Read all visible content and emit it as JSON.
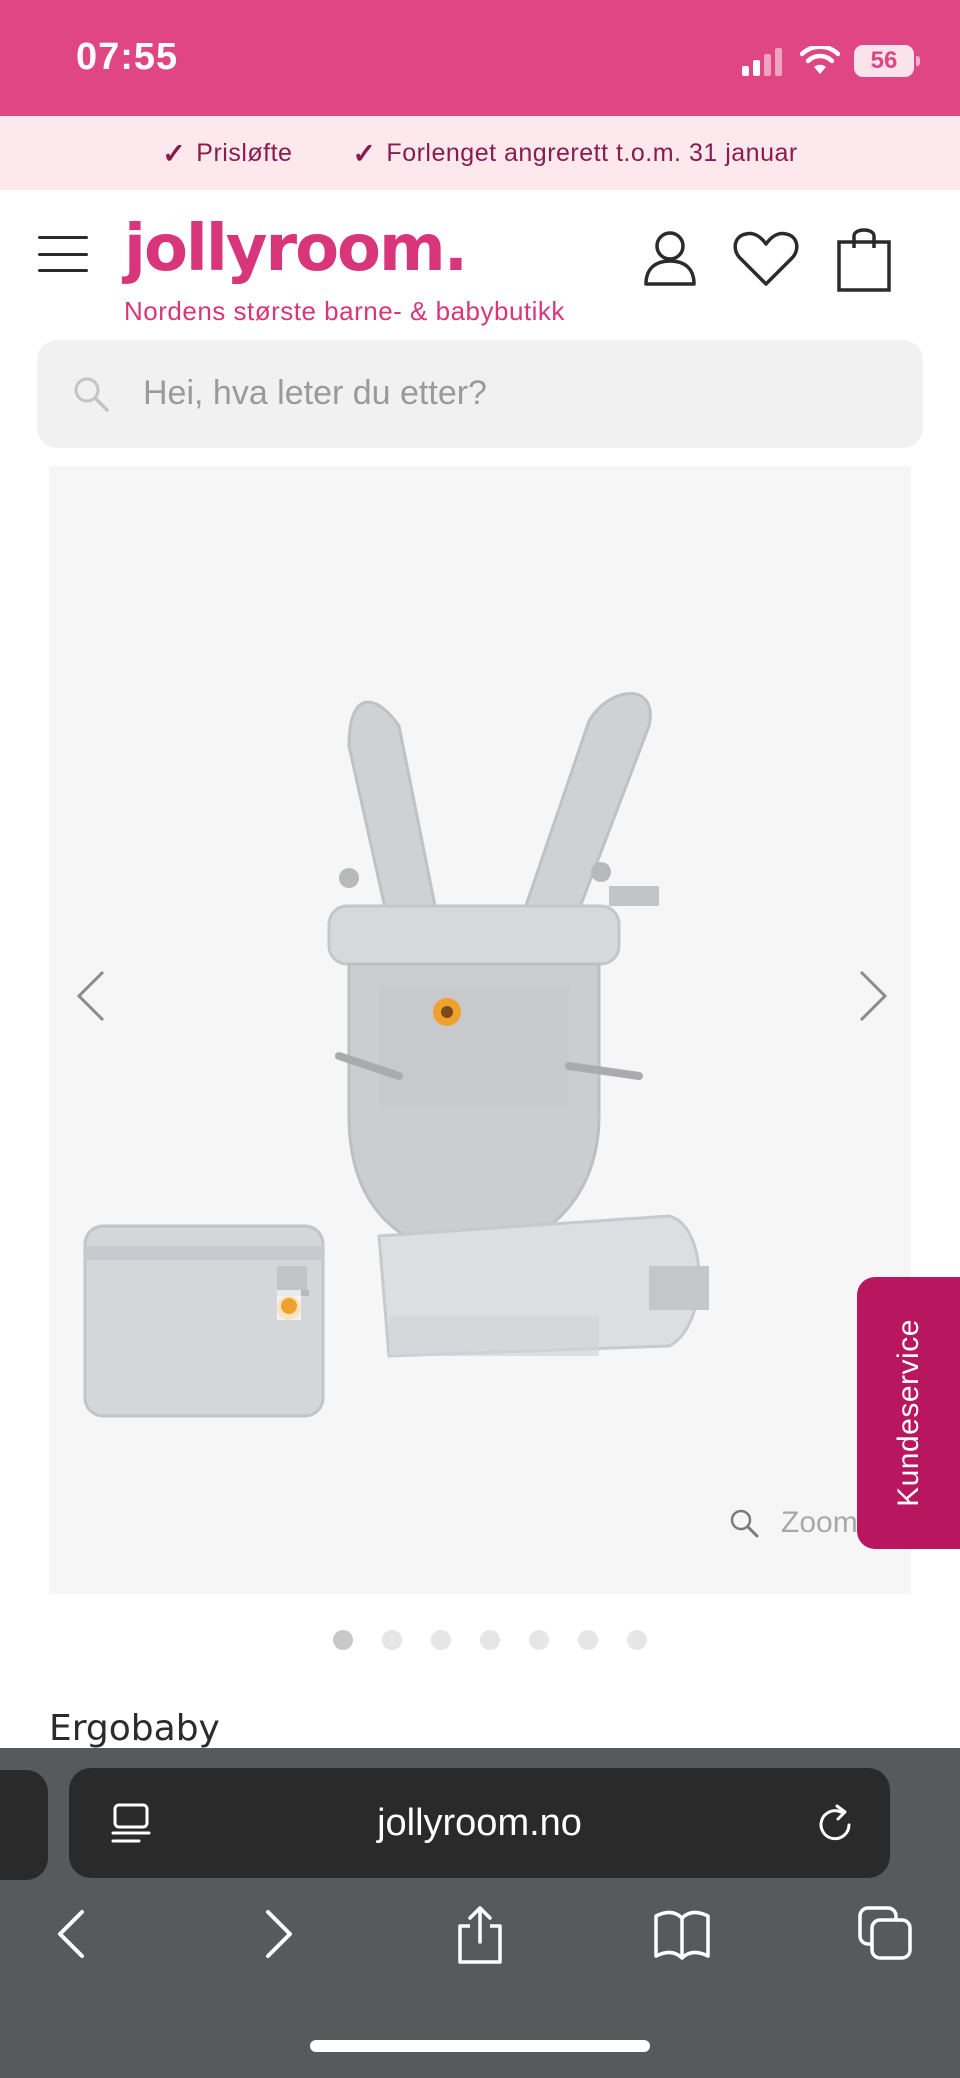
{
  "status_bar": {
    "time": "07:55",
    "battery": "56"
  },
  "promo": {
    "items": [
      {
        "label": "Prisløfte"
      },
      {
        "label": "Forlenget angrerett t.o.m. 31 januar"
      }
    ]
  },
  "header": {
    "logo": "jollyroom.",
    "tagline": "Nordens største barne- & babybutikk"
  },
  "search": {
    "placeholder": "Hei, hva leter du etter?"
  },
  "gallery": {
    "zoom_label": "Zoom",
    "total_images": 7,
    "active_index": 0
  },
  "kundeservice": {
    "label": "Kundeservice"
  },
  "product": {
    "brand": "Ergobaby"
  },
  "browser": {
    "url": "jollyroom.no"
  },
  "colors": {
    "status_bar": "#e04683",
    "brand_pink": "#d9357b",
    "promo_bg": "#fde8ee",
    "kundeservice": "#b8165f"
  }
}
